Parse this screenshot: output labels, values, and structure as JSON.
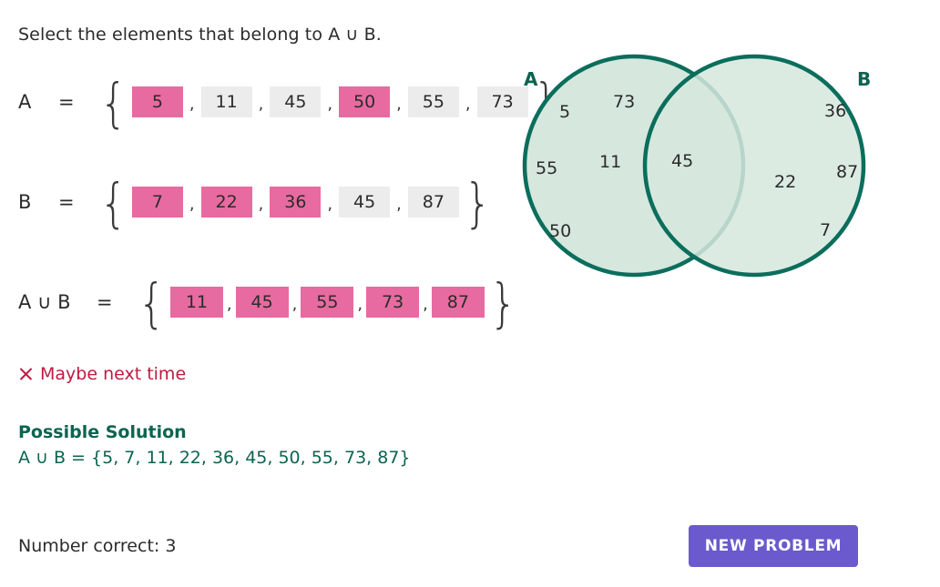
{
  "prompt": "Select the elements that belong to A ∪ B.",
  "rows": [
    {
      "name": "set-a",
      "label": "A",
      "equals": "=",
      "open_brace": "{",
      "close_brace": "}",
      "comma": ",",
      "items": [
        {
          "value": "5",
          "selected": true
        },
        {
          "value": "11",
          "selected": false
        },
        {
          "value": "45",
          "selected": false
        },
        {
          "value": "50",
          "selected": true
        },
        {
          "value": "55",
          "selected": false
        },
        {
          "value": "73",
          "selected": false
        }
      ]
    },
    {
      "name": "set-b",
      "label": "B",
      "equals": "=",
      "open_brace": "{",
      "close_brace": "}",
      "comma": ",",
      "items": [
        {
          "value": "7",
          "selected": true
        },
        {
          "value": "22",
          "selected": true
        },
        {
          "value": "36",
          "selected": true
        },
        {
          "value": "45",
          "selected": false
        },
        {
          "value": "87",
          "selected": false
        }
      ]
    },
    {
      "name": "set-union",
      "label": "A ∪ B",
      "equals": "=",
      "open_brace": "{",
      "close_brace": "}",
      "comma": ",",
      "items": [
        {
          "value": "11",
          "selected": true
        },
        {
          "value": "45",
          "selected": true
        },
        {
          "value": "55",
          "selected": true
        },
        {
          "value": "73",
          "selected": true
        },
        {
          "value": "87",
          "selected": true
        }
      ]
    }
  ],
  "feedback": {
    "icon": "x-icon",
    "text": "Maybe next time",
    "color": "#bd1b40"
  },
  "solution": {
    "title": "Possible Solution",
    "body": "A ∪ B = {5, 7, 11, 22, 36, 45, 50, 55, 73, 87}",
    "color": "#0b6450"
  },
  "footer": {
    "score_label": "Number correct: 3",
    "button_label": "NEW PROBLEM",
    "button_color": "#6a5acd"
  },
  "venn": {
    "label_a": "A",
    "label_b": "B",
    "fill": "#d6e7dd",
    "stroke": "#0b6e5c",
    "a_only": [
      "5",
      "73",
      "55",
      "11",
      "50"
    ],
    "intersection": [
      "45"
    ],
    "b_only": [
      "36",
      "87",
      "22",
      "7"
    ]
  }
}
